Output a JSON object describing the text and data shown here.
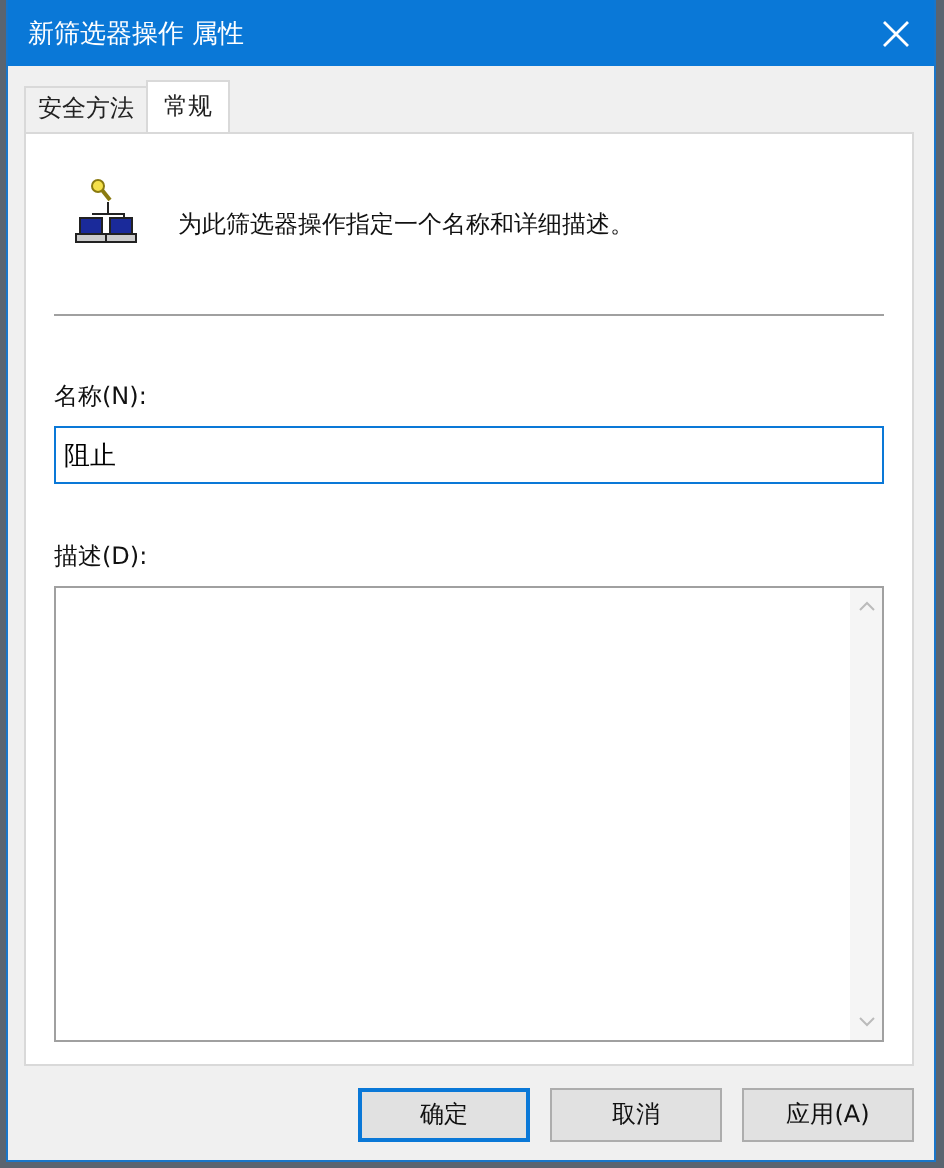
{
  "window": {
    "title": "新筛选器操作 属性"
  },
  "tabs": [
    {
      "label": "安全方法",
      "selected": false
    },
    {
      "label": "常规",
      "selected": true
    }
  ],
  "intro": "为此筛选器操作指定一个名称和详细描述。",
  "name_field": {
    "label": "名称(N):",
    "value": "阻止",
    "focused": true
  },
  "description_field": {
    "label": "描述(D):"
  },
  "buttons": [
    {
      "label": "确定",
      "default": true
    },
    {
      "label": "取消",
      "default": false
    },
    {
      "label": "应用(A)",
      "default": false
    }
  ]
}
